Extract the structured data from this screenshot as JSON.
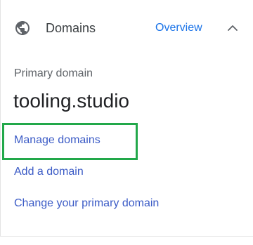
{
  "header": {
    "icon": "globe-icon",
    "title": "Domains",
    "overview_label": "Overview",
    "collapse_icon": "chevron-up-icon"
  },
  "primary": {
    "label": "Primary domain",
    "value": "tooling.studio"
  },
  "links": {
    "manage": "Manage domains",
    "add": "Add a domain",
    "change": "Change your primary domain"
  },
  "colors": {
    "link": "#3b5bc6",
    "overview": "#1a73e8",
    "highlight": "#22a84a",
    "title": "#3c4043",
    "value": "#202124"
  }
}
